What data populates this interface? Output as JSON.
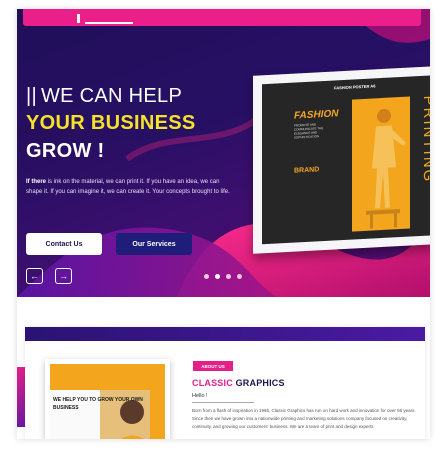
{
  "hero": {
    "headline_bars": "||",
    "headline_line1": "WE CAN HELP",
    "headline_line2": "YOUR BUSINESS",
    "headline_line3": "GROW !",
    "para_lead": "If there",
    "para_rest": " is ink on the material, we can print it. If you have an idea, we can shape it. If you can imagine it, we can create it. Your concepts brought to life.",
    "btn_contact": "Contact Us",
    "btn_services": "Our Services",
    "arrow_prev": "←",
    "arrow_next": "→",
    "slides_total": 4,
    "slide_active": 2
  },
  "poster": {
    "small_title": "FASHION POSTER A6",
    "fashion": "FASHION",
    "subtag": "PROMOTE AND COMMUNICATE THE ELEGANCE AND SOPHISTICATION",
    "brand": "BRAND",
    "printing": "PRINTING"
  },
  "about": {
    "badge": "ABOUT US",
    "title_part1": "CLASSIC",
    "title_part2": " GRAPHICS",
    "hello": "Hello !",
    "body": "Born from a flash of inspiration in 1965, Classic Graphics has run on hard work and innovation for over 56 years. Since then we have grown into a nationwide printing and marketing solutions company focused on creativity, continuity, and growing our customers' business. We are a team of print and design experts",
    "promo": "WE HELP YOU TO GROW YOUR OWN BUSINESS"
  },
  "colors": {
    "accent_pink": "#ea1f8a",
    "accent_yellow": "#f5e32a",
    "navy": "#1e1450",
    "poster_orange": "#f2a51d"
  }
}
